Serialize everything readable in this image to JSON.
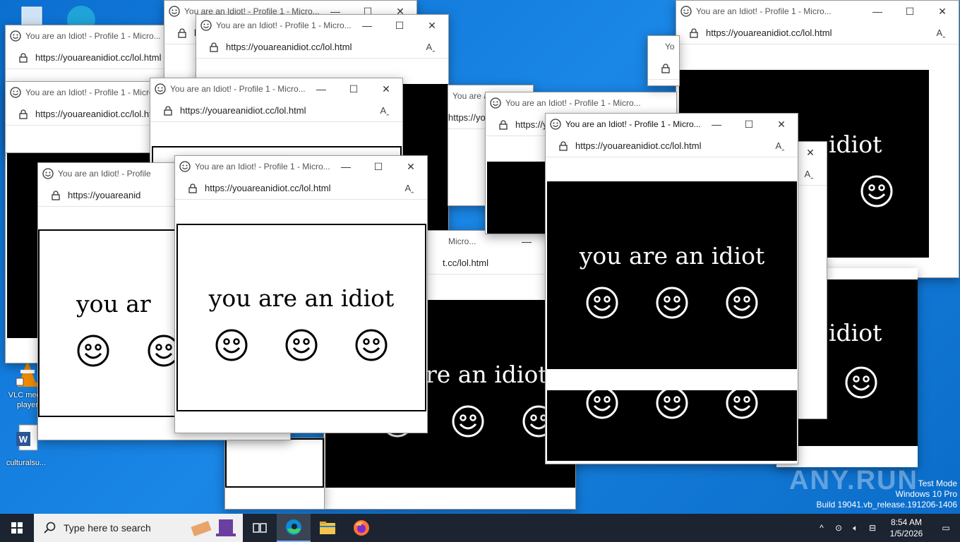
{
  "desktop": {
    "vlc_label": "VLC media player",
    "doc_label": "culturalsu..."
  },
  "browser": {
    "title": "You are an Idiot! - Profile 1 - Micro...",
    "title_short": "You are an Idiot! - Profile",
    "url": "https://youareanidiot.cc/lol.html",
    "url_short": "https://youareanid",
    "url_frag": "t.cc/lol.html",
    "title_frag": "Micro...",
    "read_aloud": "A))"
  },
  "page": {
    "message": "you are an idiot",
    "message_frag1": "you ar",
    "message_frag2": "re an idiot",
    "message_frag3": "idiot"
  },
  "taskbar": {
    "search_placeholder": "Type here to search",
    "time": "8:54 AM",
    "date": "1/5/2026"
  },
  "watermark": {
    "line1": "Test Mode",
    "line2": "Windows 10 Pro",
    "line3": "Build 19041.vb_release.191206-1406",
    "anyrun": "ANY.RUN"
  },
  "colors": {
    "desktop": "#0a75d6",
    "taskbar": "#1b2430",
    "edge_blue": "#0c8bd8",
    "edge_green": "#3ed16a"
  }
}
